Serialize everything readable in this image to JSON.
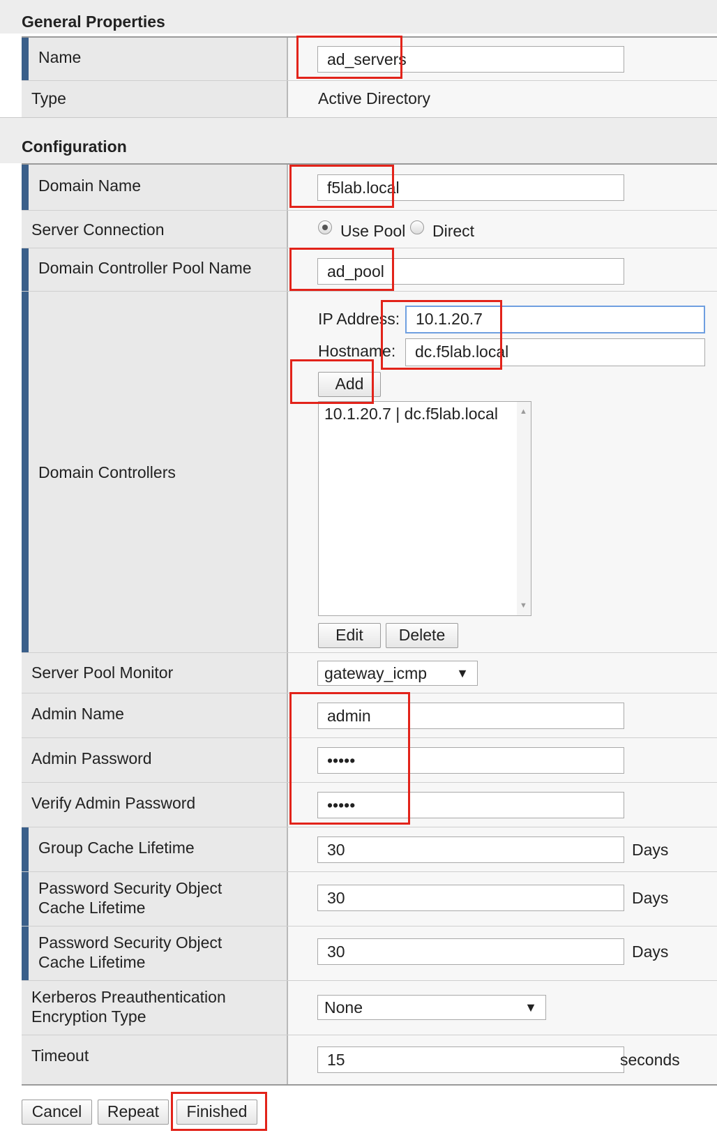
{
  "general": {
    "heading": "General Properties",
    "name_label": "Name",
    "name_value": "ad_servers",
    "type_label": "Type",
    "type_value": "Active Directory"
  },
  "config": {
    "heading": "Configuration",
    "domain_name_label": "Domain Name",
    "domain_name_value": "f5lab.local",
    "server_connection_label": "Server Connection",
    "server_connection_options": [
      "Use Pool",
      "Direct"
    ],
    "server_connection_selected": "Use Pool",
    "pool_name_label": "Domain Controller Pool Name",
    "pool_name_value": "ad_pool",
    "dc_label": "Domain Controllers",
    "ip_label": "IP Address:",
    "ip_value": "10.1.20.7",
    "hostname_label": "Hostname:",
    "hostname_value": "dc.f5lab.local",
    "add_button": "Add",
    "dc_list": [
      "10.1.20.7 | dc.f5lab.local"
    ],
    "edit_button": "Edit",
    "delete_button": "Delete",
    "monitor_label": "Server Pool Monitor",
    "monitor_value": "gateway_icmp",
    "admin_name_label": "Admin Name",
    "admin_name_value": "admin",
    "admin_password_label": "Admin Password",
    "admin_password_value": "•••••",
    "verify_password_label": "Verify Admin Password",
    "verify_password_value": "•••••",
    "group_cache_label": "Group Cache Lifetime",
    "group_cache_value": "30",
    "group_cache_unit": "Days",
    "pso_cache_label_line1": "Password Security Object",
    "pso_cache_label_line2": "Cache Lifetime",
    "pso_cache_value": "30",
    "pso_cache_unit": "Days",
    "pso_cache2_label_line1": "Password Security Object",
    "pso_cache2_label_line2": "Cache Lifetime",
    "pso_cache2_value": "30",
    "pso_cache2_unit": "Days",
    "kerberos_label_line1": "Kerberos Preauthentication",
    "kerberos_label_line2": "Encryption Type",
    "kerberos_value": "None",
    "timeout_label": "Timeout",
    "timeout_value": "15",
    "timeout_unit": "seconds"
  },
  "footer": {
    "cancel": "Cancel",
    "repeat": "Repeat",
    "finished": "Finished"
  },
  "colors": {
    "required_bar": "#3a5f8a",
    "highlight": "#e2231a",
    "focus_border": "#6f9fe0"
  }
}
